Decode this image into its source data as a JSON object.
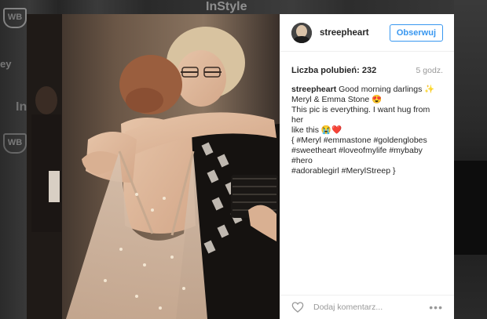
{
  "background": {
    "logo_wb": "WB",
    "logo_instyle": "InStyle",
    "logo_ey": "ey",
    "logo_in": "In"
  },
  "post": {
    "username": "streepheart",
    "follow_label": "Obserwuj",
    "likes": "Liczba polubień: 232",
    "time": "5 godz.",
    "caption_user": "streepheart",
    "caption_lines": [
      "Good morning darlings ✨",
      "Meryl & Emma Stone 😍",
      "This pic is everything. I want hug from her",
      "like this 😭❤️",
      "{ #Meryl #emmastone #goldenglobes",
      "#sweetheart #loveofmylife #mybaby #hero",
      "#adorablegirl #MerylStreep }"
    ],
    "comment_placeholder": "Dodaj komentarz...",
    "more_label": "•••"
  },
  "colors": {
    "accent": "#3897f0",
    "text": "#262626",
    "muted": "#999999"
  },
  "icons": {
    "like": "heart-outline-icon",
    "more": "more-options-icon"
  }
}
